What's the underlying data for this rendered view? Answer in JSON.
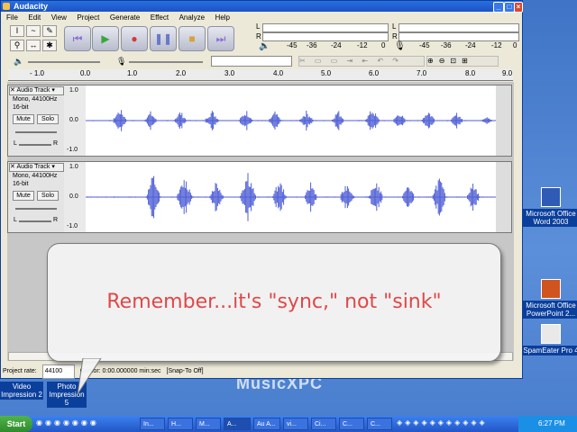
{
  "window": {
    "title": "Audacity"
  },
  "menu": [
    "File",
    "Edit",
    "View",
    "Project",
    "Generate",
    "Effect",
    "Analyze",
    "Help"
  ],
  "meters": {
    "left_label": "L",
    "right_label": "R",
    "ticks": [
      "-45",
      "-36",
      "-24",
      "-12",
      "0"
    ]
  },
  "ruler_ticks": [
    "- 1.0",
    "0.0",
    "1.0",
    "2.0",
    "3.0",
    "4.0",
    "5.0",
    "6.0",
    "7.0",
    "8.0",
    "9.0"
  ],
  "tracks": [
    {
      "name": "Audio Track",
      "info1": "Mono, 44100Hz",
      "info2": "16-bit",
      "mute": "Mute",
      "solo": "Solo",
      "pan_l": "L",
      "pan_r": "R",
      "y_top": "1.0",
      "y_mid": "0.0",
      "y_bottom": "-1.0"
    },
    {
      "name": "Audio Track",
      "info1": "Mono, 44100Hz",
      "info2": "16-bit",
      "mute": "Mute",
      "solo": "Solo",
      "pan_l": "L",
      "pan_r": "R",
      "y_top": "1.0",
      "y_mid": "0.0",
      "y_bottom": "-1.0"
    }
  ],
  "status": {
    "project_rate_label": "Project rate:",
    "project_rate": "44100",
    "cursor": "Cursor: 0:00.000000 min:sec",
    "snap": "[Snap-To Off]"
  },
  "callout": {
    "text": "Remember...it's \"sync,\" not \"sink\""
  },
  "desktop_icons": [
    {
      "label": "Microsoft Office Word 2003"
    },
    {
      "label": "Microsoft Office PowerPoint 2..."
    },
    {
      "label": "SpamEater Pro 4"
    },
    {
      "label": "Video Impression 2"
    },
    {
      "label": "Photo Impression 5"
    }
  ],
  "brand_text": "MusicXPC",
  "taskbar": {
    "start": "Start",
    "tasks": [
      "In...",
      "H...",
      "M...",
      "A...",
      "Au A...",
      "vi...",
      "Ci...",
      "C...",
      "C..."
    ],
    "clock": "6:27 PM"
  },
  "colors": {
    "wave": "#4f5fd6",
    "callout_text": "#e04848",
    "desktop": "#4a7fcf"
  }
}
